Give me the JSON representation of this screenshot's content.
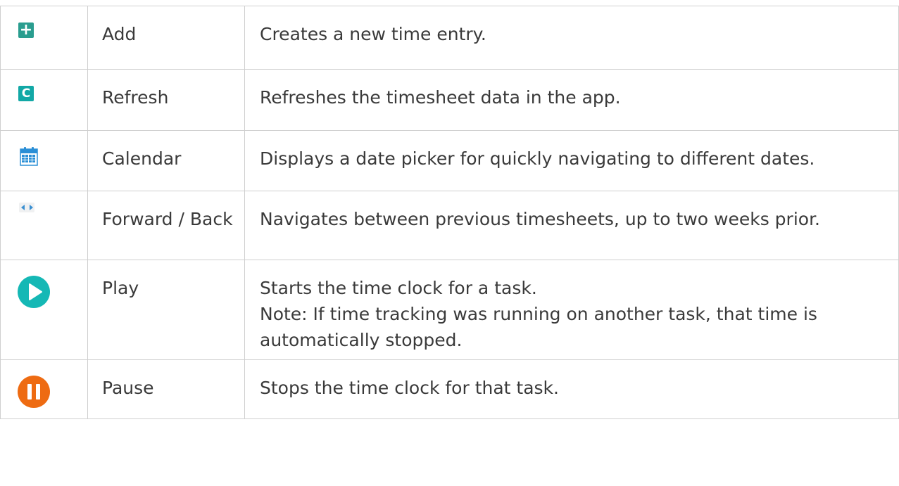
{
  "rows": [
    {
      "icon": "add-icon",
      "name": "Add",
      "description": [
        "Creates a new time entry."
      ]
    },
    {
      "icon": "refresh-icon",
      "name": "Refresh",
      "description": [
        "Refreshes the timesheet data in the app."
      ]
    },
    {
      "icon": "calendar-icon",
      "name": "Calendar",
      "description": [
        "Displays a date picker for quickly navigating to different dates."
      ]
    },
    {
      "icon": "forward-back-arrows-icon",
      "name": "Forward / Back",
      "description": [
        "Navigates between previous timesheets, up to two weeks prior."
      ]
    },
    {
      "icon": "play-icon",
      "name": "Play",
      "description": [
        "Starts the time clock for a task.",
        "Note: If time tracking was running on another task, that time is automatically stopped."
      ]
    },
    {
      "icon": "pause-icon",
      "name": "Pause",
      "description": [
        "Stops the time clock for that task."
      ]
    }
  ],
  "colors": {
    "add": "#2a9d8f",
    "refresh": "#12a8a6",
    "calendar": "#2b8fd6",
    "play": "#15b8b5",
    "pause": "#ee6b12",
    "text": "#3a3a3a",
    "border": "#cfcfcf"
  }
}
